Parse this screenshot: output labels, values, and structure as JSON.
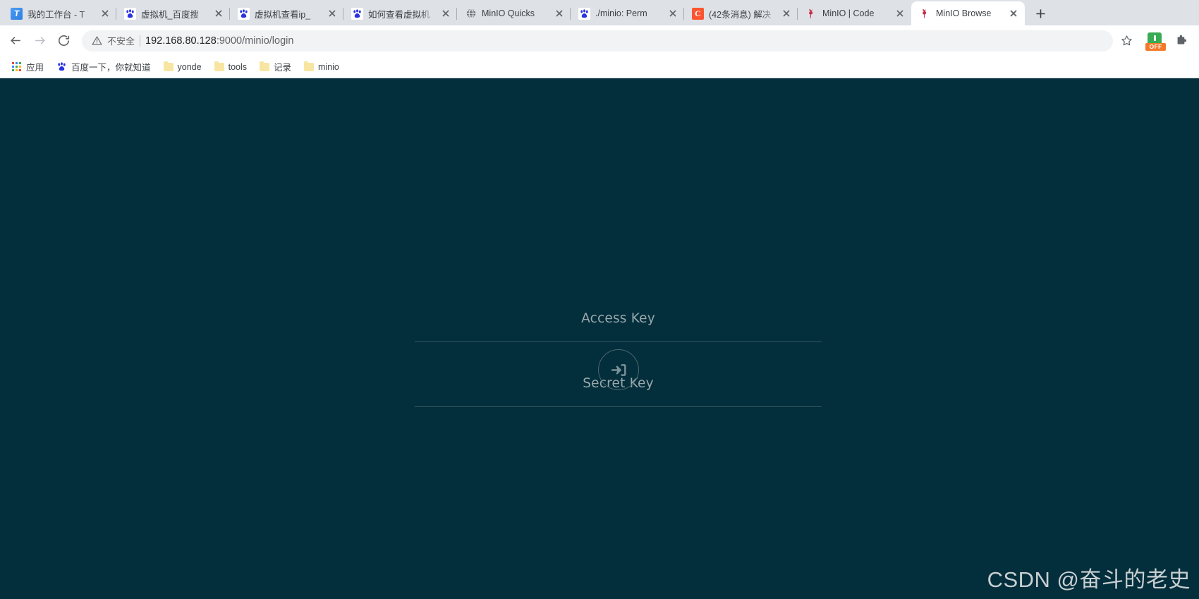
{
  "browser": {
    "tabs": [
      {
        "title": "我的工作台 - T",
        "favicon": "teamwork-icon",
        "active": false
      },
      {
        "title": "虚拟机_百度搜",
        "favicon": "baidu-icon",
        "active": false
      },
      {
        "title": "虚拟机查看ip_",
        "favicon": "baidu-icon",
        "active": false
      },
      {
        "title": "如何查看虚拟机",
        "favicon": "baidu-icon",
        "active": false
      },
      {
        "title": "MinIO Quicks",
        "favicon": "globe-icon",
        "active": false
      },
      {
        "title": "./minio: Perm",
        "favicon": "baidu-icon",
        "active": false
      },
      {
        "title": "(42条消息) 解决",
        "favicon": "csdn-icon",
        "active": false
      },
      {
        "title": "MinIO | Code",
        "favicon": "minio-icon",
        "active": false
      },
      {
        "title": "MinIO Browse",
        "favicon": "minio-icon",
        "active": true
      }
    ],
    "new_tab_label": "+",
    "close_label": "×",
    "toolbar": {
      "back_label": "←",
      "forward_label": "→",
      "reload_label": "⟳",
      "security_text": "不安全",
      "url": "192.168.80.128:9000/minio/login",
      "url_host": "192.168.80.128",
      "url_rest": ":9000/minio/login",
      "bookmark_star_label": "☆",
      "extension_badge": "OFF",
      "extensions_label": "扩展程序"
    },
    "bookmarks": [
      {
        "label": "应用",
        "icon": "apps-grid-icon"
      },
      {
        "label": "百度一下，你就知道",
        "icon": "baidu-icon"
      },
      {
        "label": "yonde",
        "icon": "folder-icon"
      },
      {
        "label": "tools",
        "icon": "folder-icon"
      },
      {
        "label": "记录",
        "icon": "folder-icon"
      },
      {
        "label": "minio",
        "icon": "folder-icon"
      }
    ]
  },
  "page": {
    "background_color": "#032e3c",
    "accent_color": "#9aa9ac",
    "login": {
      "access_key_label": "Access Key",
      "access_key_value": "",
      "secret_key_label": "Secret Key",
      "secret_key_value": "",
      "submit_label": "登录"
    },
    "watermark": "CSDN @奋斗的老史"
  }
}
